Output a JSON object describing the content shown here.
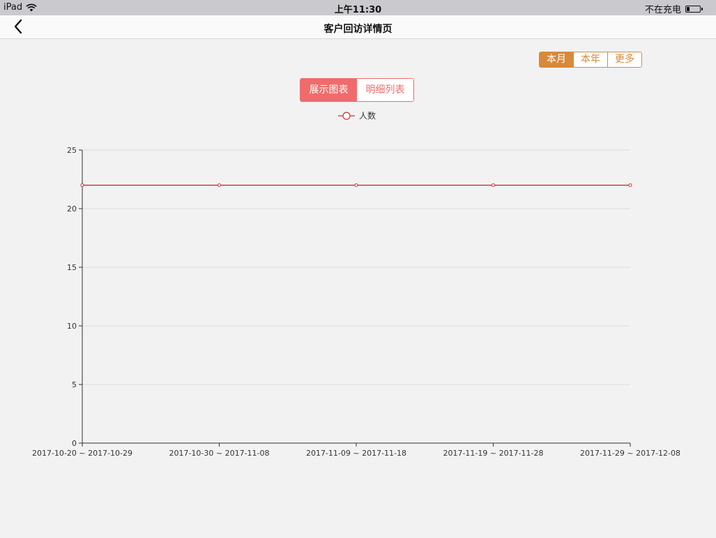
{
  "status_bar": {
    "device": "iPad",
    "time": "上午11:30",
    "battery_status": "不在充电"
  },
  "nav": {
    "title": "客户回访详情页",
    "back_icon": "chevron-left-icon"
  },
  "period_tabs": [
    {
      "label": "本月",
      "active": true
    },
    {
      "label": "本年",
      "active": false
    },
    {
      "label": "更多",
      "active": false
    }
  ],
  "view_tabs": [
    {
      "label": "展示图表",
      "active": true
    },
    {
      "label": "明细列表",
      "active": false
    }
  ],
  "colors": {
    "period_accent": "#d9893a",
    "view_accent": "#f06b6b",
    "series_line": "#c23531"
  },
  "chart_data": {
    "type": "line",
    "categories": [
      "2017-10-20 ~ 2017-10-29",
      "2017-10-30 ~ 2017-11-08",
      "2017-11-09 ~ 2017-11-18",
      "2017-11-19 ~ 2017-11-28",
      "2017-11-29 ~ 2017-12-08"
    ],
    "series": [
      {
        "name": "人数",
        "values": [
          22,
          22,
          22,
          22,
          22
        ]
      }
    ],
    "ylim": [
      0,
      25
    ],
    "yticks": [
      0,
      5,
      10,
      15,
      20,
      25
    ],
    "grid": true,
    "legend": "top-center"
  }
}
